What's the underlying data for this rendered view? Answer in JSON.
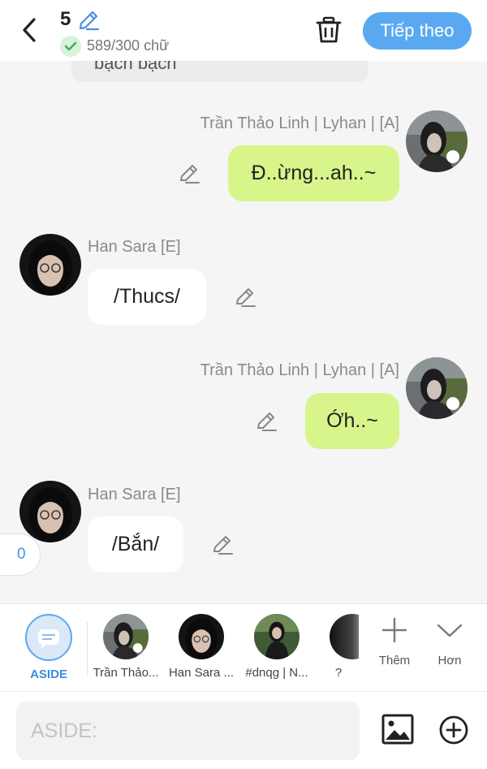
{
  "header": {
    "chapter_number": "5",
    "word_count": "589/300 chữ",
    "next_label": "Tiếp theo"
  },
  "chat": {
    "previous_text": "bạch bạch",
    "messages": [
      {
        "side": "right",
        "name": "Trần Thảo Linh | Lyhan | [A]",
        "text": "Đ..ừng...ah..~"
      },
      {
        "side": "left",
        "name": "Han Sara [E]",
        "text": "/Thucs/"
      },
      {
        "side": "right",
        "name": "Trần Thảo Linh | Lyhan | [A]",
        "text": "Ớh..~"
      },
      {
        "side": "left",
        "name": "Han Sara [E]",
        "text": "/Bắn/"
      }
    ],
    "side_count": "0"
  },
  "charbar": {
    "aside_label": "ASIDE",
    "characters": [
      {
        "label": "Trần Thảo..."
      },
      {
        "label": "Han Sara ..."
      },
      {
        "label": "#dnqg | N..."
      },
      {
        "label": "?"
      }
    ],
    "add_label": "Thêm",
    "more_label": "Hơn"
  },
  "input": {
    "placeholder": "ASIDE:"
  },
  "colors": {
    "accent": "#5aa9f0",
    "bubble_green": "#d8f58c",
    "bubble_white": "#ffffff",
    "background": "#f5f5f5"
  }
}
